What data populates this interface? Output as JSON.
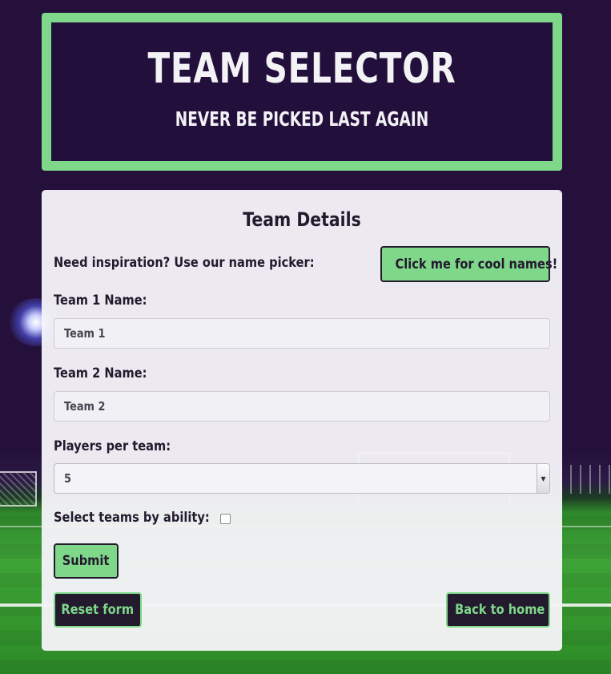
{
  "header": {
    "title": "TEAM SELECTOR",
    "subtitle": "NEVER BE PICKED LAST AGAIN"
  },
  "form": {
    "title": "Team Details",
    "inspiration_label": "Need inspiration? Use our name picker:",
    "cool_names_button": "Click me for cool names!",
    "team1_label": "Team 1 Name:",
    "team1_value": "Team 1",
    "team2_label": "Team 2 Name:",
    "team2_value": "Team 2",
    "players_label": "Players per team:",
    "players_value": "5",
    "ability_label": "Select teams by ability:",
    "ability_checked": false,
    "submit_button": "Submit",
    "reset_button": "Reset form",
    "home_button": "Back to home"
  },
  "colors": {
    "accent_green": "#7fd88a",
    "dark_purple": "#231a2e",
    "header_bg": "#230f3b",
    "card_bg": "#f5f4f8"
  },
  "icons": {
    "select_arrow": "chevron-down-icon"
  }
}
